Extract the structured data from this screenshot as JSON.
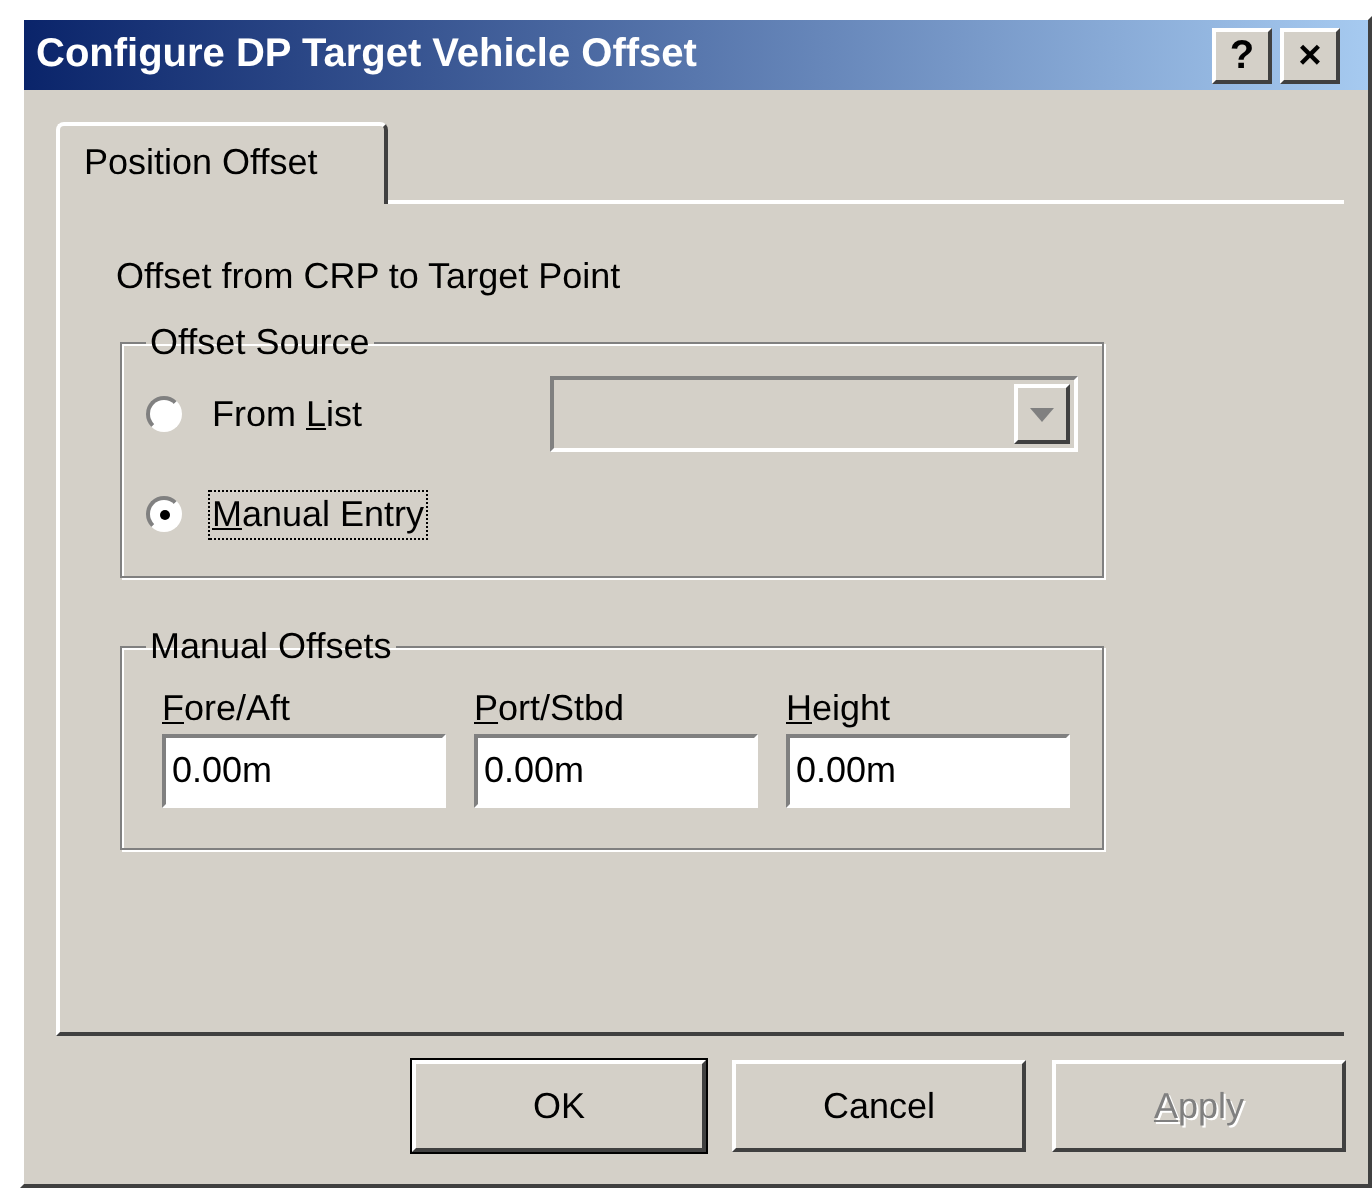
{
  "window": {
    "title": "Configure DP Target Vehicle Offset",
    "title_buttons": [
      "?",
      "×"
    ]
  },
  "tabs": [
    {
      "label": "Position Offset",
      "selected": true
    }
  ],
  "description": "Offset from CRP to Target Point",
  "offset_source": {
    "title": "Offset Source",
    "options": [
      {
        "label": {
          "before": "From ",
          "access_key": "L",
          "after": "ist"
        },
        "selected": false,
        "focused": false
      },
      {
        "label": {
          "access_key": "M",
          "after": "anual Entry"
        },
        "selected": true,
        "focused": true
      }
    ],
    "list": {
      "disabled": true
    }
  },
  "manual_offsets": {
    "title": "Manual Offsets",
    "fields": [
      {
        "label": {
          "access_key": "F",
          "after": "ore/Aft"
        },
        "value": "0.00m"
      },
      {
        "label": {
          "access_key": "P",
          "after": "ort/Stbd"
        },
        "value": "0.00m"
      },
      {
        "label": {
          "access_key": "H",
          "after": "eight"
        },
        "value": "0.00m"
      }
    ]
  },
  "buttons": [
    {
      "label": {
        "before": "OK"
      },
      "default": true,
      "disabled": false
    },
    {
      "label": {
        "before": "Cancel"
      },
      "default": false,
      "disabled": false
    },
    {
      "label": {
        "access_key": "A",
        "after": "pply"
      },
      "default": false,
      "disabled": true
    }
  ]
}
